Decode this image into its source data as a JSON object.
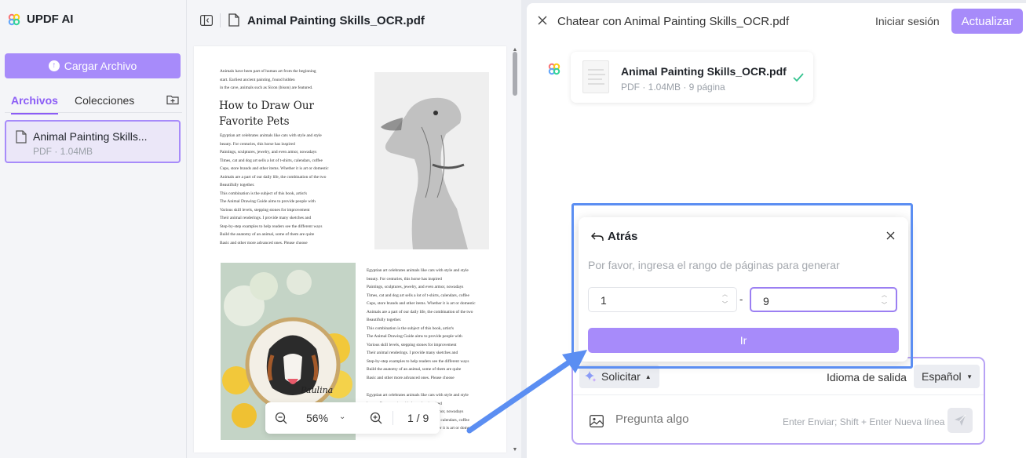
{
  "app": {
    "name": "UPDF AI"
  },
  "sidebar": {
    "upload_label": "Cargar Archivo",
    "tabs": [
      "Archivos",
      "Colecciones"
    ],
    "file": {
      "name": "Animal Painting Skills...",
      "meta": "PDF · 1.04MB"
    }
  },
  "viewer": {
    "doc_title": "Animal Painting Skills_OCR.pdf",
    "zoom": "56%",
    "page_indicator": "1 / 9",
    "page": {
      "intro": [
        "Animals have been part of human art from the beginning",
        "start. Earliest ancient painting, found hidden",
        "in the cave, animals such as Sicon (bison) are featured."
      ],
      "heading": [
        "How to Draw Our",
        "Favorite Pets"
      ],
      "body": [
        "Egyptian art celebrates animals like cats with style and style",
        "beauty. For centuries, this horse has inspired",
        "Paintings, sculptures, jewelry, and even armor, nowadays",
        "Times, cat and dog art sells a lot of t-shirts, calendars, coffee",
        "Cups, store brands and other items. Whether it is art or domestic",
        "Animals are a part of our daily life, the combination of the two",
        "Beautifully together.",
        "This combination is the subject of this book, artist's",
        "The Animal Drawing Guide aims to provide people with",
        "Various skill levels, stepping stones for improvement",
        "Their animal renderings. I provide many sketches and",
        "Step-by-step examples to help readers see the different ways",
        "Build the anatomy of an animal, some of them are quite",
        "Basic and other more advanced ones. Please choose"
      ],
      "body2": [
        "Egyptian art celebrates animals like cats with style and style",
        "beauty. For centuries, this horse has inspired",
        "Paintings, sculptures, jewelry, and even armor, nowadays",
        "Times, cat and dog art sells a lot of t-shirts, calendars, coffee",
        "Cups, store brands and other items. Whether it is art or domestic",
        "Animals are a part of our daily life, the combination of the two",
        "Beautifully together.",
        "This combination is the subject of this book, artist's",
        "The Animal Drawing Guide aims to provide people with",
        "Various skill levels, stepping stones for improvement",
        "Their animal renderings. I provide many sketches and",
        "Step-by-step examples to help readers see the different ways",
        "Build the anatomy of an animal, some of them are quite",
        "Basic and other more advanced ones. Please choose"
      ],
      "body3": [
        "Egyptian art celebrates animals like cats with style and style",
        "beauty. For centuries, this horse has inspired",
        "Paintings, sculptures, jewelry, and even armor, nowadays",
        "Times, cat and dog art sells a lot of t-shirts, calendars, coffee",
        "Cups, store brands and other items. Whether it is art or domestic"
      ],
      "embroidery_text": "Paulina"
    }
  },
  "chat": {
    "title": "Chatear con Animal Painting Skills_OCR.pdf",
    "login": "Iniciar sesión",
    "upgrade": "Actualizar",
    "attachment": {
      "name": "Animal Painting Skills_OCR.pdf",
      "meta": "PDF · 1.04MB · 9 página"
    },
    "popup": {
      "back": "Atrás",
      "hint": "Por favor, ingresa el rango de páginas para generar",
      "from": "1",
      "to": "9",
      "dash": "-",
      "go": "Ir"
    },
    "input": {
      "mode": "Solicitar",
      "lang_label": "Idioma de salida",
      "lang_value": "Español",
      "placeholder": "Pregunta algo",
      "hint": "Enter Enviar; Shift + Enter Nueva línea"
    }
  },
  "colors": {
    "accent": "#a78bfa",
    "accent_dark": "#8b5cf6",
    "highlight": "#5b8ef2"
  },
  "icons": [
    "updf-logo-icon",
    "upload-icon",
    "folder-add-icon",
    "file-icon",
    "sidebar-toggle-icon",
    "close-icon",
    "check-icon",
    "sparkle-icon",
    "image-icon",
    "send-icon",
    "zoom-out-icon",
    "zoom-in-icon",
    "back-arrow-icon"
  ]
}
